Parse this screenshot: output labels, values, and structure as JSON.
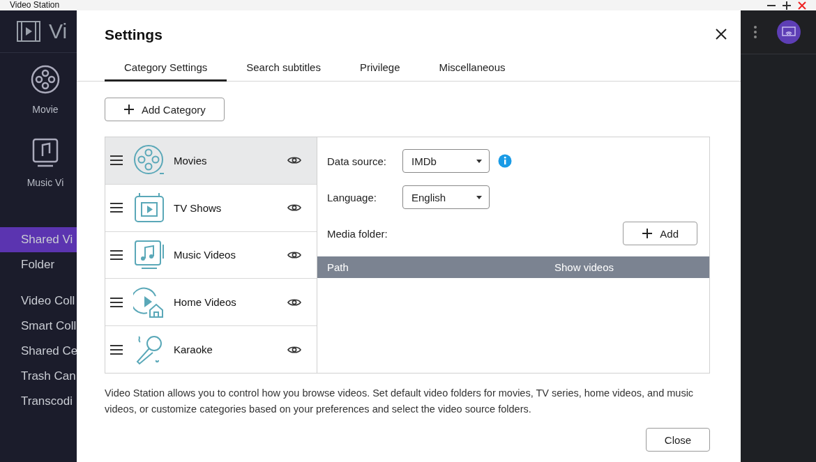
{
  "window": {
    "title": "Video Station"
  },
  "app": {
    "title": "Vi",
    "nav": [
      {
        "label": "Movie",
        "kind": "tile"
      },
      {
        "label": "Music Vi",
        "kind": "tile"
      }
    ],
    "sidebar": [
      {
        "label": "Shared Vi",
        "selected": true
      },
      {
        "label": "Folder",
        "selected": false
      },
      {
        "label": "Video Coll",
        "selected": false
      },
      {
        "label": "Smart Coll",
        "selected": false
      },
      {
        "label": "Shared Ce",
        "selected": false
      },
      {
        "label": "Trash Can",
        "selected": false
      },
      {
        "label": "Transcodi",
        "selected": false
      }
    ]
  },
  "dialog": {
    "title": "Settings",
    "tabs": [
      {
        "label": "Category Settings",
        "selected": true
      },
      {
        "label": "Search subtitles",
        "selected": false
      },
      {
        "label": "Privilege",
        "selected": false
      },
      {
        "label": "Miscellaneous",
        "selected": false
      }
    ],
    "add_button": "Add Category",
    "categories": [
      {
        "label": "Movies",
        "kind": "movies",
        "selected": true
      },
      {
        "label": "TV Shows",
        "kind": "tv",
        "selected": false
      },
      {
        "label": "Music Videos",
        "kind": "music",
        "selected": false
      },
      {
        "label": "Home Videos",
        "kind": "home",
        "selected": false
      },
      {
        "label": "Karaoke",
        "kind": "karaoke",
        "selected": false
      }
    ],
    "data_source": {
      "label": "Data source:",
      "value": "IMDb"
    },
    "language": {
      "label": "Language:",
      "value": "English"
    },
    "media_folder": {
      "label": "Media folder:",
      "button": "Add"
    },
    "table": {
      "columns": [
        "Path",
        "Show videos"
      ]
    },
    "description": "Video Station allows you to control how you browse videos. Set default video folders for movies, TV series, home videos, and music videos, or customize categories based on your preferences and select the video source folders.",
    "close_button": "Close"
  }
}
